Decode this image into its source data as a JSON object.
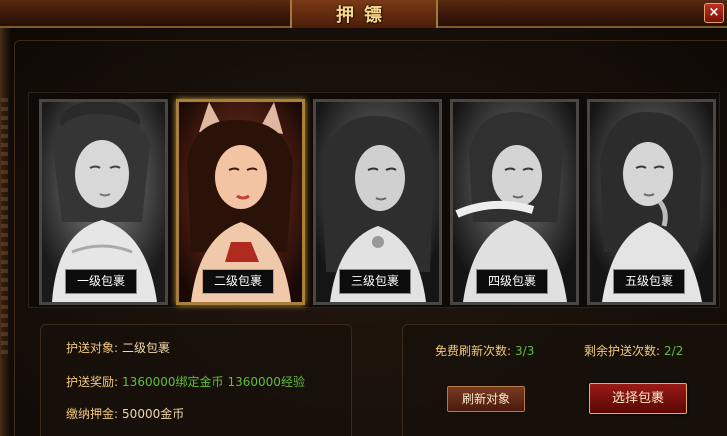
{
  "window": {
    "title": "押镖",
    "close_glyph": "×"
  },
  "packages": [
    {
      "label": "一级包裹",
      "selected": false
    },
    {
      "label": "二级包裹",
      "selected": true
    },
    {
      "label": "三级包裹",
      "selected": false
    },
    {
      "label": "四级包裹",
      "selected": false
    },
    {
      "label": "五级包裹",
      "selected": false
    }
  ],
  "info": {
    "target_label": "护送对象:",
    "target_value": "二级包裹",
    "reward_label": "护送奖励:",
    "reward_gold": "1360000绑定金币",
    "reward_exp": "1360000经验",
    "deposit_label": "缴纳押金:",
    "deposit_value": "50000金币"
  },
  "stats": {
    "free_refresh_label": "免费刷新次数:",
    "free_refresh_value": "3/3",
    "escort_left_label": "剩余护送次数:",
    "escort_left_value": "2/2"
  },
  "buttons": {
    "refresh": "刷新对象",
    "choose": "选择包裹"
  },
  "colors": {
    "selected_border": "#a8803a",
    "green_value": "#5fbf3a",
    "title_gold": "#f7d88a"
  }
}
